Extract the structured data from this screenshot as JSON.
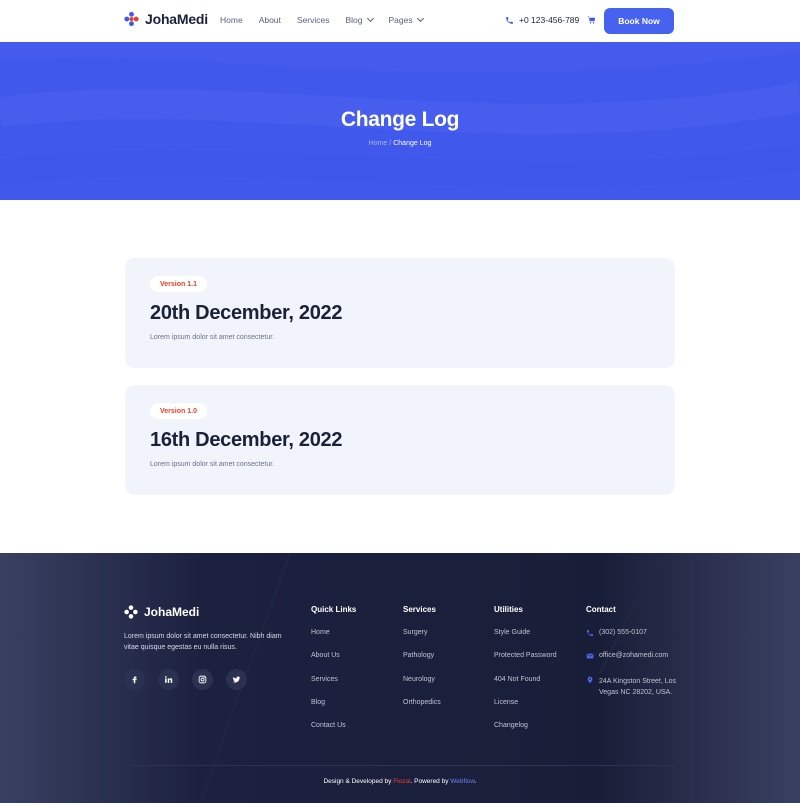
{
  "header": {
    "brand": "JohaMedi",
    "nav": [
      "Home",
      "About",
      "Services",
      "Blog",
      "Pages"
    ],
    "phone": "+0 123-456-789",
    "book_label": "Book Now"
  },
  "hero": {
    "title": "Change Log",
    "breadcrumb_home": "Home",
    "breadcrumb_sep": "/",
    "breadcrumb_current": "Change Log"
  },
  "changelog": [
    {
      "version": "Version 1.1",
      "date": "20th December, 2022",
      "description": "Lorem ipsum dolor sit amet consectetur."
    },
    {
      "version": "Version 1.0",
      "date": "16th December, 2022",
      "description": "Lorem ipsum dolor sit amet consectetur."
    }
  ],
  "footer": {
    "brand": "JohaMedi",
    "description": "Lorem ipsum dolor sit amet consectetur. Nibh diam vitae quisque egestas eu nulla risus.",
    "socials": [
      "facebook-icon",
      "linkedin-icon",
      "instagram-icon",
      "twitter-icon"
    ],
    "quick_links": {
      "title": "Quick Links",
      "items": [
        "Home",
        "About Us",
        "Services",
        "Blog",
        "Contact Us"
      ]
    },
    "services": {
      "title": "Services",
      "items": [
        "Surgery",
        "Pathology",
        "Neurology",
        "Orthopedics"
      ]
    },
    "utilities": {
      "title": "Utilities",
      "items": [
        "Style Guide",
        "Protected Password",
        "404 Not Found",
        "License",
        "Changelog"
      ]
    },
    "contact": {
      "title": "Contact",
      "phone": "(302) 555-0107",
      "email": "office@zohamedi.com",
      "address_line1": "24A Kingston Street, Los",
      "address_line2": "Vegas NC 28202, USA."
    },
    "copyright_prefix": "Design & Developed by ",
    "copyright_brand": "Flozai",
    "copyright_mid": ". Powered by ",
    "copyright_platform": "Webflow",
    "copyright_suffix": "."
  },
  "colors": {
    "primary": "#4158ec",
    "accent_red": "#e8412b",
    "footer_bg": "#191e38",
    "card_bg": "#f2f4fc"
  }
}
